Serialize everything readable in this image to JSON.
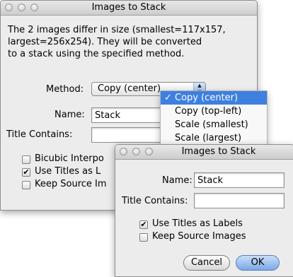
{
  "back_dialog": {
    "title": "Images to Stack",
    "message_lines": [
      "The 2 images differ in size (smallest=117x157,",
      "largest=256x254). They will be converted",
      "to a stack using the specified method."
    ],
    "method_label": "Method:",
    "method_value": "Copy (center)",
    "name_label": "Name:",
    "name_value": "Stack",
    "title_contains_label": "Title Contains:",
    "title_contains_value": "",
    "checkboxes": [
      {
        "label": "Bicubic Interpo",
        "checked": false
      },
      {
        "label": "Use Titles as L",
        "checked": true
      },
      {
        "label": "Keep Source Im",
        "checked": false
      }
    ]
  },
  "method_menu": {
    "items": [
      {
        "label": "Copy (center)",
        "selected": true,
        "checkmark": "✓"
      },
      {
        "label": "Copy (top-left)",
        "selected": false,
        "checkmark": ""
      },
      {
        "label": "Scale (smallest)",
        "selected": false,
        "checkmark": ""
      },
      {
        "label": "Scale (largest)",
        "selected": false,
        "checkmark": ""
      }
    ]
  },
  "front_dialog": {
    "title": "Images to Stack",
    "name_label": "Name:",
    "name_value": "Stack",
    "title_contains_label": "Title Contains:",
    "title_contains_value": "",
    "use_titles_label": "Use Titles as Labels",
    "use_titles_checked": true,
    "keep_source_label": "Keep Source Images",
    "keep_source_checked": false,
    "cancel_label": "Cancel",
    "ok_label": "OK"
  },
  "check_glyph": "✔",
  "popup_arrow_up": "▲",
  "popup_arrow_down": "▼"
}
